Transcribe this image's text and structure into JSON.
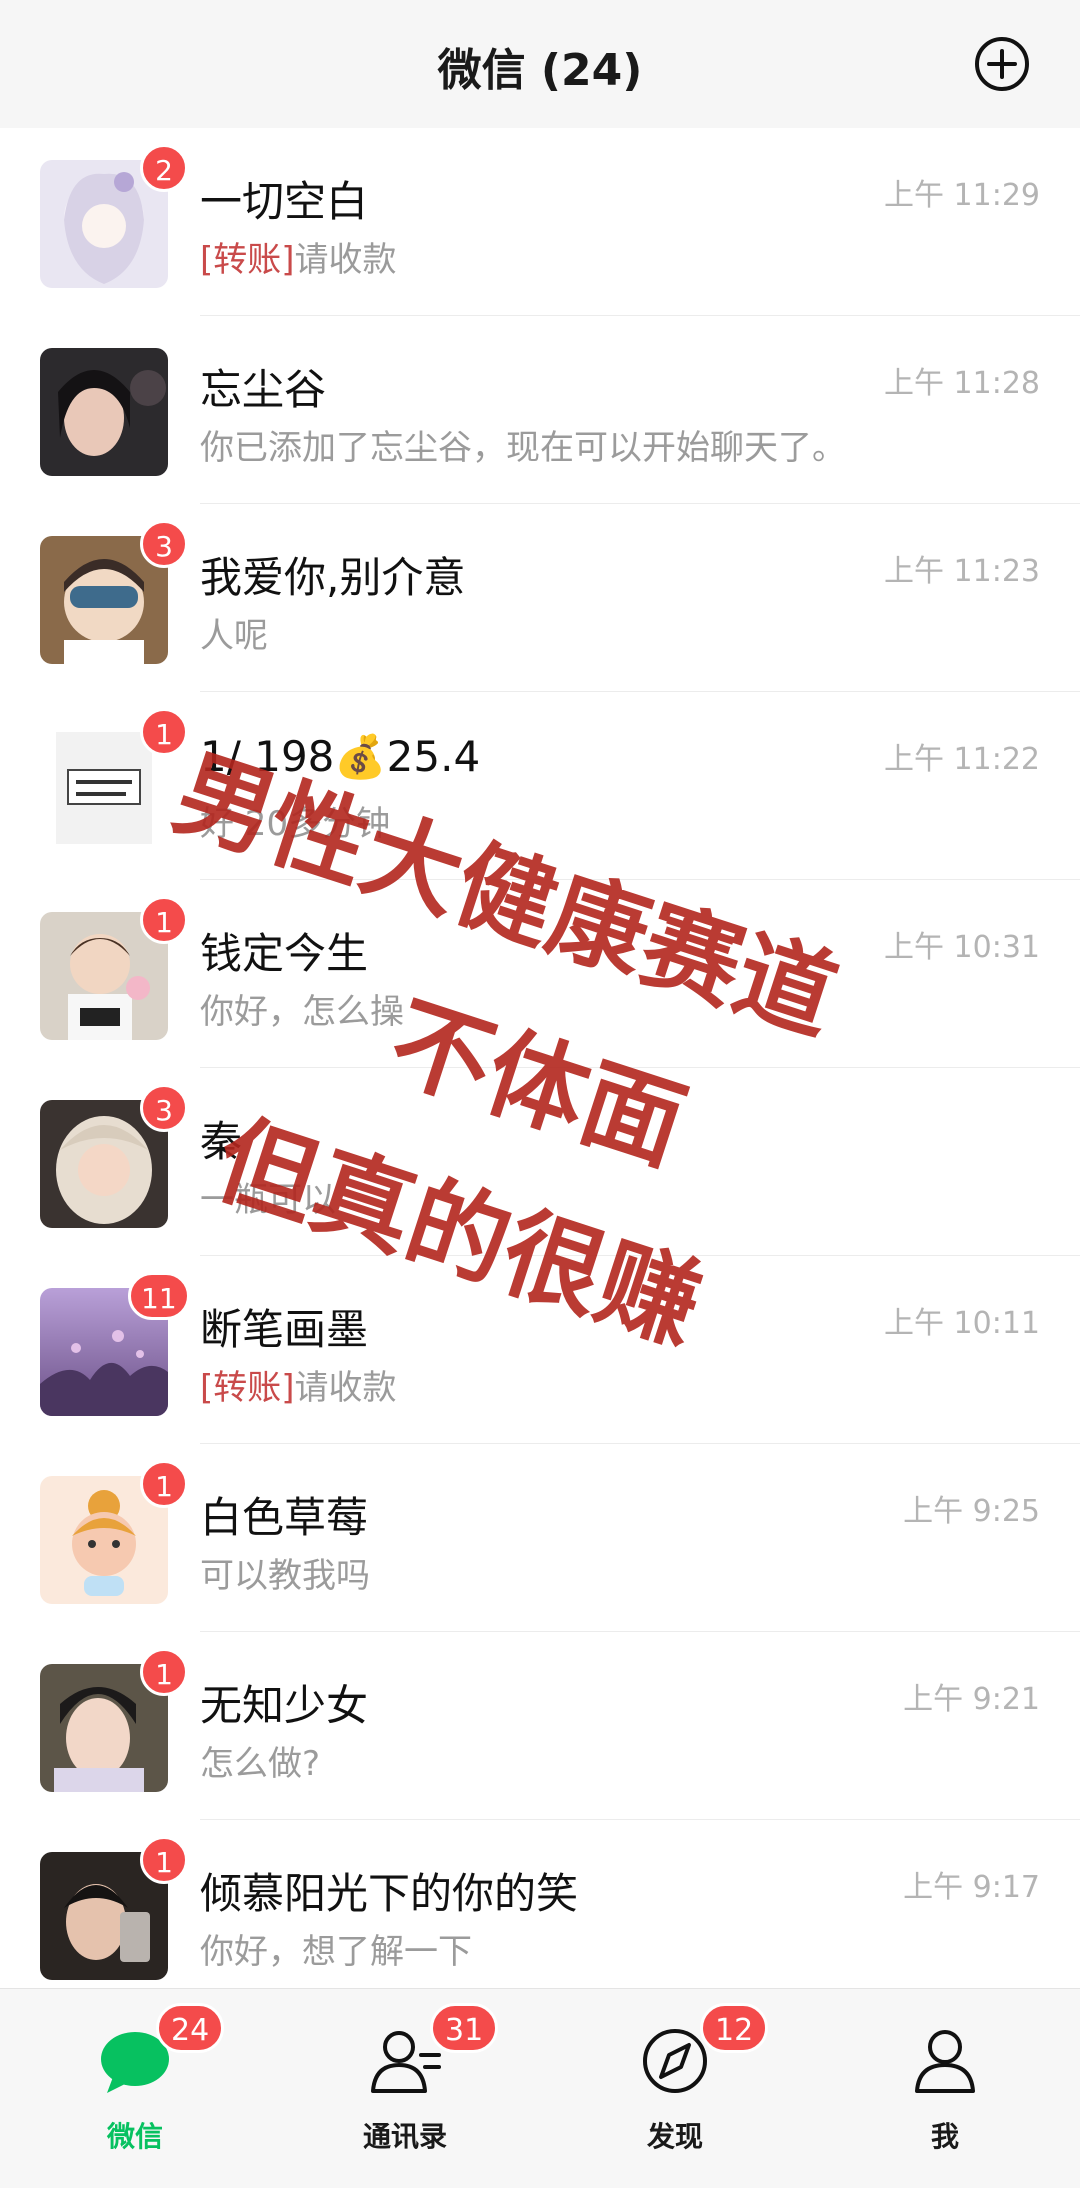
{
  "header": {
    "title": "微信 (24)",
    "add_icon": "plus-circle-icon"
  },
  "chats": [
    {
      "name": "一切空白",
      "tag": "[转账]",
      "preview": "请收款",
      "time": "上午 11:29",
      "badge": "2"
    },
    {
      "name": "忘尘谷",
      "tag": "",
      "preview": "你已添加了忘尘谷，现在可以开始聊天了。",
      "time": "上午 11:28",
      "badge": ""
    },
    {
      "name": "我爱你,别介意",
      "tag": "",
      "preview": "人呢",
      "time": "上午 11:23",
      "badge": "3"
    },
    {
      "name": "1/ 198💰25.4",
      "tag": "",
      "preview": "好 20多分钟",
      "time": "上午 11:22",
      "badge": "1"
    },
    {
      "name": "钱定今生",
      "tag": "",
      "preview": "你好，怎么操",
      "time": "上午 10:31",
      "badge": "1"
    },
    {
      "name": "秦",
      "tag": "",
      "preview": "一瓶可以",
      "time": "",
      "badge": "3"
    },
    {
      "name": "断笔画墨",
      "tag": "[转账]",
      "preview": "请收款",
      "time": "上午 10:11",
      "badge": "11"
    },
    {
      "name": "白色草莓",
      "tag": "",
      "preview": "可以教我吗",
      "time": "上午 9:25",
      "badge": "1"
    },
    {
      "name": "无知少女",
      "tag": "",
      "preview": "怎么做?",
      "time": "上午 9:21",
      "badge": "1"
    },
    {
      "name": "倾慕阳光下的你的笑",
      "tag": "",
      "preview": "你好，想了解一下",
      "time": "上午 9:17",
      "badge": "1"
    }
  ],
  "tabs": [
    {
      "label": "微信",
      "badge": "24",
      "icon": "chat-bubble-icon",
      "active": true
    },
    {
      "label": "通讯录",
      "badge": "31",
      "icon": "contacts-icon",
      "active": false
    },
    {
      "label": "发现",
      "badge": "12",
      "icon": "compass-icon",
      "active": false
    },
    {
      "label": "我",
      "badge": "",
      "icon": "person-icon",
      "active": false
    }
  ],
  "overlay_text": [
    "男性大健康赛道",
    "不体面",
    "但真的很赚"
  ],
  "colors": {
    "accent_green": "#07c160",
    "badge_red": "#f44b4b",
    "transfer_tag": "#c94a4a",
    "overlay_red": "#b3261e"
  }
}
